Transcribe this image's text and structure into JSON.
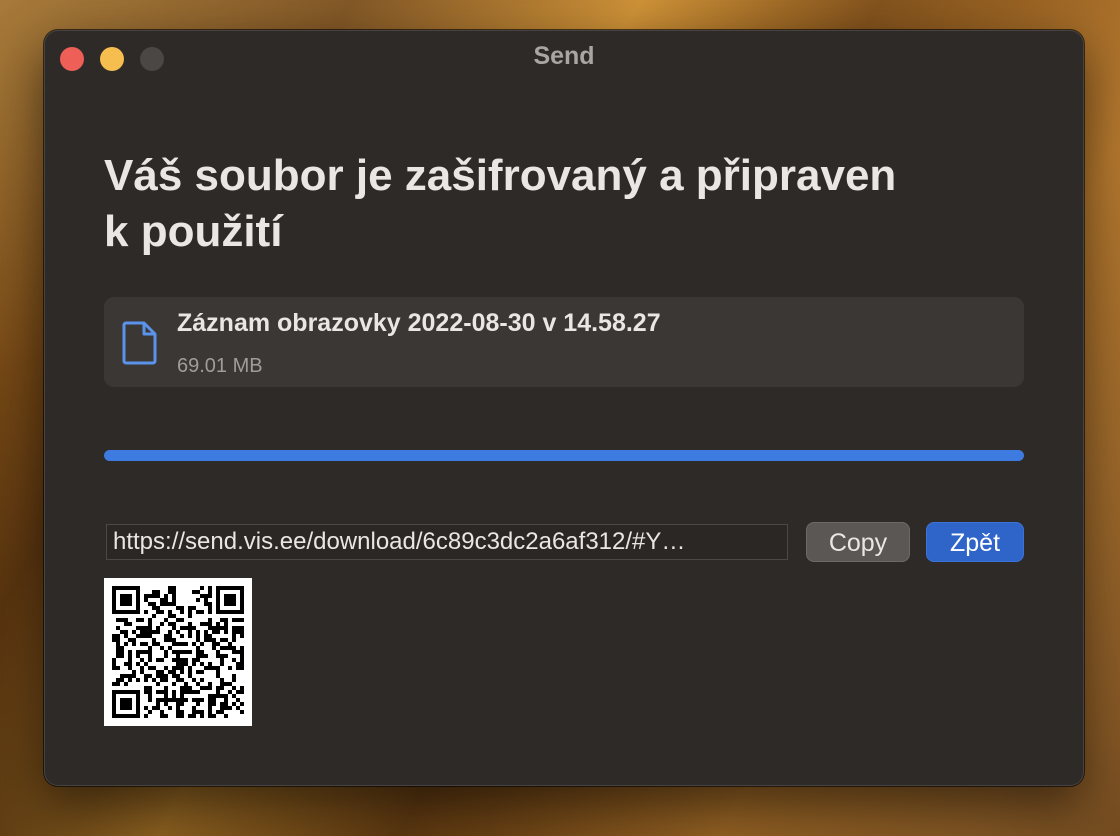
{
  "window": {
    "title": "Send"
  },
  "main": {
    "heading_line1": "Váš soubor je zašifrovaný a připraven",
    "heading_line2": "k použití"
  },
  "file": {
    "name": "Záznam obrazovky 2022-08-30 v 14.58.27",
    "size": "69.01 MB",
    "icon": "document-icon"
  },
  "progress": {
    "fraction": 1.0
  },
  "share": {
    "url": "https://send.vis.ee/download/6c89c3dc2a6af312/#Y…",
    "copy_label": "Copy",
    "back_label": "Zpět"
  },
  "colors": {
    "accent": "#3d7be0",
    "button_primary": "#2f64c9",
    "window_bg": "#2d2a28",
    "close": "#ee5f57",
    "minimize": "#f5be4f",
    "maximize_disabled": "#4a4745"
  },
  "qr_code": {
    "icon": "qr-code-icon"
  }
}
